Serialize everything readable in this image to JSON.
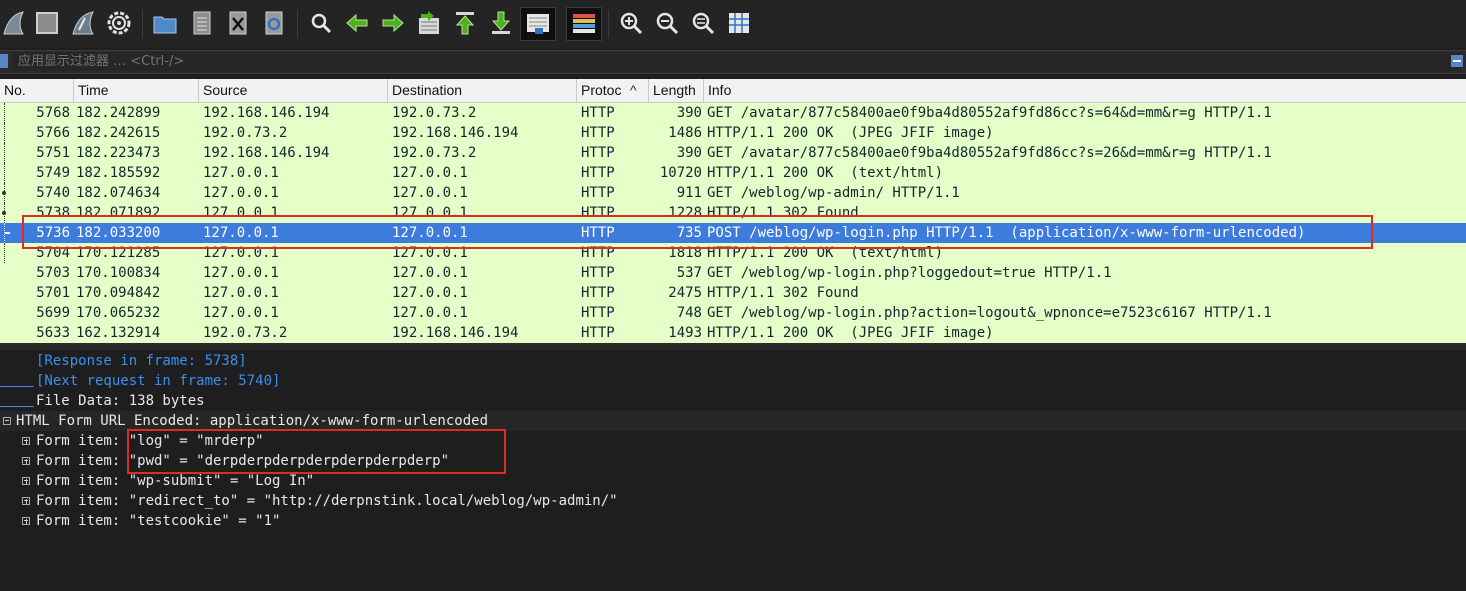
{
  "colors": {
    "toolbar_bg": "#242424",
    "row_bg_http": "#e4ffc7",
    "row_text": "#12272e",
    "selected_row_bg": "#3d7bdc",
    "annotation_red": "#e02b20",
    "details_bg": "#1e1e1e",
    "link": "#3d8ef0"
  },
  "toolbar": {
    "icons": [
      "shark-fin-icon",
      "stop-icon",
      "shark-restart-icon",
      "gear-icon",
      "open-folder-icon",
      "file-icon",
      "close-file-icon",
      "reload-icon",
      "search-icon",
      "back-arrow-icon",
      "forward-arrow-icon",
      "go-to-packet-icon",
      "first-packet-icon",
      "last-packet-icon",
      "autoscroll-icon",
      "colorize-icon",
      "zoom-in-icon",
      "zoom-out-icon",
      "zoom-reset-icon",
      "resize-columns-icon"
    ]
  },
  "filter": {
    "placeholder": "应用显示过滤器 … <Ctrl-/>"
  },
  "packet_list": {
    "columns": [
      "No.",
      "Time",
      "Source",
      "Destination",
      "Protoc",
      "Length",
      "Info"
    ],
    "sort_indicator": "^",
    "rows": [
      {
        "no": "5768",
        "time": "182.242899",
        "src": "192.168.146.194",
        "dst": "192.0.73.2",
        "proto": "HTTP",
        "len": "390",
        "info": "GET /avatar/877c58400ae0f9ba4d80552af9fd86cc?s=64&d=mm&r=g HTTP/1.1"
      },
      {
        "no": "5766",
        "time": "182.242615",
        "src": "192.0.73.2",
        "dst": "192.168.146.194",
        "proto": "HTTP",
        "len": "1486",
        "info": "HTTP/1.1 200 OK  (JPEG JFIF image)"
      },
      {
        "no": "5751",
        "time": "182.223473",
        "src": "192.168.146.194",
        "dst": "192.0.73.2",
        "proto": "HTTP",
        "len": "390",
        "info": "GET /avatar/877c58400ae0f9ba4d80552af9fd86cc?s=26&d=mm&r=g HTTP/1.1"
      },
      {
        "no": "5749",
        "time": "182.185592",
        "src": "127.0.0.1",
        "dst": "127.0.0.1",
        "proto": "HTTP",
        "len": "10720",
        "info": "HTTP/1.1 200 OK  (text/html)"
      },
      {
        "no": "5740",
        "time": "182.074634",
        "src": "127.0.0.1",
        "dst": "127.0.0.1",
        "proto": "HTTP",
        "len": "911",
        "info": "GET /weblog/wp-admin/ HTTP/1.1"
      },
      {
        "no": "5738",
        "time": "182.071892",
        "src": "127.0.0.1",
        "dst": "127.0.0.1",
        "proto": "HTTP",
        "len": "1228",
        "info": "HTTP/1.1 302 Found"
      },
      {
        "no": "5736",
        "time": "182.033200",
        "src": "127.0.0.1",
        "dst": "127.0.0.1",
        "proto": "HTTP",
        "len": "735",
        "info": "POST /weblog/wp-login.php HTTP/1.1  (application/x-www-form-urlencoded)"
      },
      {
        "no": "5704",
        "time": "170.121285",
        "src": "127.0.0.1",
        "dst": "127.0.0.1",
        "proto": "HTTP",
        "len": "1818",
        "info": "HTTP/1.1 200 OK  (text/html)"
      },
      {
        "no": "5703",
        "time": "170.100834",
        "src": "127.0.0.1",
        "dst": "127.0.0.1",
        "proto": "HTTP",
        "len": "537",
        "info": "GET /weblog/wp-login.php?loggedout=true HTTP/1.1"
      },
      {
        "no": "5701",
        "time": "170.094842",
        "src": "127.0.0.1",
        "dst": "127.0.0.1",
        "proto": "HTTP",
        "len": "2475",
        "info": "HTTP/1.1 302 Found"
      },
      {
        "no": "5699",
        "time": "170.065232",
        "src": "127.0.0.1",
        "dst": "127.0.0.1",
        "proto": "HTTP",
        "len": "748",
        "info": "GET /weblog/wp-login.php?action=logout&_wpnonce=e7523c6167 HTTP/1.1"
      },
      {
        "no": "5633",
        "time": "162.132914",
        "src": "192.0.73.2",
        "dst": "192.168.146.194",
        "proto": "HTTP",
        "len": "1493",
        "info": "HTTP/1.1 200 OK  (JPEG JFIF image)"
      }
    ]
  },
  "details": {
    "response_link": "[Response in frame: 5738]",
    "next_request_link": "[Next request in frame: 5740]",
    "file_data": "File Data: 138 bytes",
    "form_header": "HTML Form URL Encoded: application/x-www-form-urlencoded",
    "form_items": [
      "Form item: \"log\" = \"mrderp\"",
      "Form item: \"pwd\" = \"derpderpderpderpderpderpderp\"",
      "Form item: \"wp-submit\" = \"Log In\"",
      "Form item: \"redirect_to\" = \"http://derpnstink.local/weblog/wp-admin/\"",
      "Form item: \"testcookie\" = \"1\""
    ]
  }
}
